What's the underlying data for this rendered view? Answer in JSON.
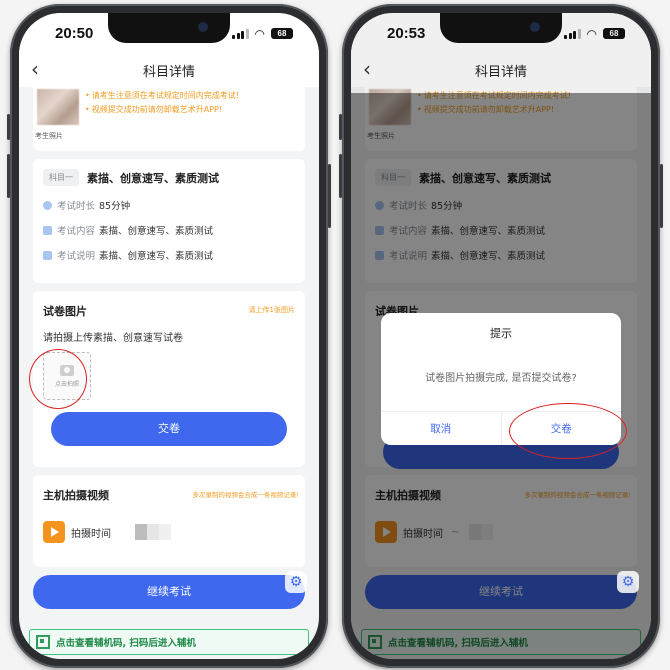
{
  "left": {
    "status": {
      "time": "20:50",
      "battery": "68"
    },
    "nav": {
      "title": "科目详情"
    },
    "notices": [
      "请考生注意须在考试规定时间内完成考试!",
      "视频提交成功前请勿卸载艺术升APP!"
    ],
    "photo_label": "考生照片",
    "subject": {
      "tag": "科目一",
      "name": "素描、创意速写、素质测试",
      "duration_label": "考试时长",
      "duration_value": "85分钟",
      "content_label": "考试内容",
      "content_value": "素描、创意速写、素质测试",
      "desc_label": "考试说明",
      "desc_value": "素描、创意速写、素质测试"
    },
    "paper": {
      "title": "试卷图片",
      "hint": "请上传1张图片",
      "desc": "请拍摄上传素描、创意速写试卷",
      "upload_label": "点击拍照",
      "submit_label": "交卷"
    },
    "video": {
      "title": "主机拍摄视频",
      "hint": "多次录制的视频会合成一条视频记录!",
      "time_label": "拍摄时间"
    },
    "continue_label": "继续考试",
    "aux_text": "点击查看辅机码, 扫码后进入辅机"
  },
  "right": {
    "status": {
      "time": "20:53",
      "battery": "68"
    },
    "nav": {
      "title": "科目详情"
    },
    "notices": [
      "请考生注意须在考试规定时间内完成考试!",
      "视频提交成功前请勿卸载艺术升APP!"
    ],
    "photo_label": "考生照片",
    "subject": {
      "tag": "科目一",
      "name": "素描、创意速写、素质测试",
      "duration_label": "考试时长",
      "duration_value": "85分钟",
      "content_label": "考试内容",
      "content_value": "素描、创意速写、素质测试",
      "desc_label": "考试说明",
      "desc_value": "素描、创意速写、素质测试"
    },
    "paper": {
      "title": "试卷图片"
    },
    "video": {
      "title": "主机拍摄视频",
      "hint": "多次录制的视频会合成一条视频记录!",
      "time_label": "拍摄时间",
      "time_value": "~"
    },
    "continue_label": "继续考试",
    "aux_text": "点击查看辅机码, 扫码后进入辅机",
    "dialog": {
      "title": "提示",
      "message": "试卷图片拍摄完成, 是否提交试卷?",
      "cancel_label": "取消",
      "confirm_label": "交卷"
    }
  }
}
